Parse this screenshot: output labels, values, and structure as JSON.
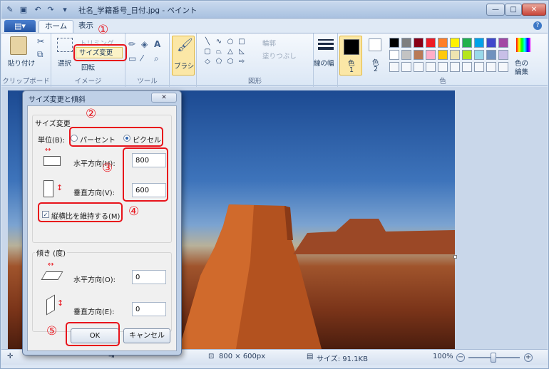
{
  "window": {
    "title": "社名_学籍番号_日付.jpg - ペイント",
    "minimize": "—",
    "maximize": "□",
    "close": "✕"
  },
  "tabs": {
    "app_menu": "▤▾",
    "home": "ホーム",
    "view": "表示",
    "help": "?"
  },
  "ribbon": {
    "clipboard": {
      "paste": "貼り付け",
      "label": "クリップボード"
    },
    "image": {
      "select": "選択",
      "crop": "トリミング",
      "resize": "サイズ変更",
      "rotate": "回転",
      "label": "イメージ"
    },
    "tools": {
      "label": "ツール"
    },
    "brush": {
      "label": "ブラシ"
    },
    "shapes": {
      "outline": "輪郭",
      "fill": "塗りつぶし",
      "label": "図形"
    },
    "size": {
      "label": "線の幅"
    },
    "colors": {
      "color1": "色\n1",
      "color1_a": "色",
      "color1_b": "1",
      "color2_a": "色",
      "color2_b": "2",
      "edit_a": "色の",
      "edit_b": "編集",
      "label": "色",
      "palette_row1": [
        "#000000",
        "#7f7f7f",
        "#880015",
        "#ed1c24",
        "#ff7f27",
        "#fff200",
        "#22b14c",
        "#00a2e8",
        "#3f48cc",
        "#a349a4"
      ],
      "palette_row2": [
        "#ffffff",
        "#c3c3c3",
        "#b97a57",
        "#ffaec9",
        "#ffc90e",
        "#efe4b0",
        "#b5e61d",
        "#99d9ea",
        "#7092be",
        "#c8bfe7"
      ]
    }
  },
  "dialog": {
    "title": "サイズ変更と傾斜",
    "close": "✕",
    "resize_section": "サイズ変更",
    "unit_label": "単位(B):",
    "unit_percent": "パーセント",
    "unit_pixel": "ピクセル",
    "horizontal_label": "水平方向(H):",
    "horizontal_value": "800",
    "vertical_label": "垂直方向(V):",
    "vertical_value": "600",
    "keep_ratio": "縦横比を維持する(M)",
    "skew_section": "傾き (度)",
    "skew_h_label": "水平方向(O):",
    "skew_h_value": "0",
    "skew_v_label": "垂直方向(E):",
    "skew_v_value": "0",
    "ok": "OK",
    "cancel": "キャンセル"
  },
  "annotations": [
    "①",
    "②",
    "③",
    "④",
    "⑤"
  ],
  "status": {
    "dimensions": "800 × 600px",
    "file_size": "サイズ: 91.1KB",
    "zoom": "100%",
    "zoom_out": "−",
    "zoom_in": "+"
  }
}
